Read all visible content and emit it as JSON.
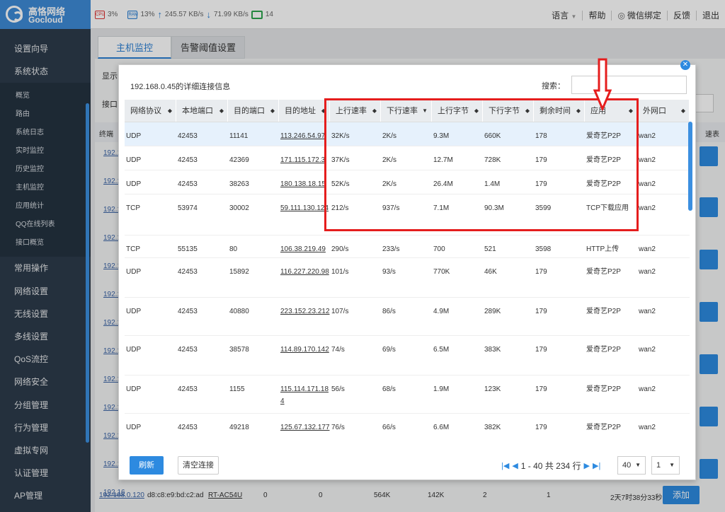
{
  "brand": {
    "name_cn": "高恪网络",
    "name_en": "Gocloud"
  },
  "stats": {
    "cpu_icon": "CPU",
    "cpu": "3%",
    "ram_icon": "RAM",
    "ram": "13%",
    "up": "245.57 KB/s",
    "down": "71.99 KB/s",
    "devices": "14"
  },
  "topnav": {
    "language": "语言",
    "help": "帮助",
    "wechat": "微信绑定",
    "feedback": "反馈",
    "logout": "退出"
  },
  "sidebar": {
    "setup": "设置向导",
    "status": "系统状态",
    "sub": [
      "概览",
      "路由",
      "系统日志",
      "实时监控",
      "历史监控",
      "主机监控",
      "应用统计",
      "QQ在线列表",
      "接口概览"
    ],
    "items": [
      "常用操作",
      "网络设置",
      "无线设置",
      "多线设置",
      "QoS流控",
      "网络安全",
      "分组管理",
      "行为管理",
      "虚拟专网",
      "认证管理",
      "AP管理"
    ]
  },
  "tabs": [
    "主机监控",
    "告警阈值设置"
  ],
  "background": {
    "display_label": "显示",
    "iface_label": "接口",
    "terminal_label": "终端",
    "speed_label": "速表",
    "row_ip": "192.16",
    "bottom": {
      "ip": "192.168.0.120",
      "mac": "d8:c8:e9:bd:c2:ad",
      "model": "RT-AC54U",
      "c1": "0",
      "c2": "0",
      "c3": "564K",
      "c4": "142K",
      "c5": "2",
      "c6": "1",
      "uptime": "2天7时38分33秒",
      "add": "添加"
    }
  },
  "modal": {
    "title": "192.168.0.45的详细连接信息",
    "search_label": "搜索：",
    "search_value": "",
    "columns": [
      "网络协议",
      "本地端口",
      "目的端口",
      "目的地址",
      "上行速率",
      "下行速率",
      "上行字节",
      "下行字节",
      "剩余时间",
      "应用",
      "外网口"
    ],
    "rows": [
      [
        "UDP",
        "42453",
        "11141",
        "113.246.54.97",
        "32K/s",
        "2K/s",
        "9.3M",
        "660K",
        "178",
        "爱奇艺P2P",
        "wan2"
      ],
      [
        "UDP",
        "42453",
        "42369",
        "171.115.172.3",
        "37K/s",
        "2K/s",
        "12.7M",
        "728K",
        "179",
        "爱奇艺P2P",
        "wan2"
      ],
      [
        "UDP",
        "42453",
        "38263",
        "180.138.18.15",
        "52K/s",
        "2K/s",
        "26.4M",
        "1.4M",
        "179",
        "爱奇艺P2P",
        "wan2"
      ],
      [
        "TCP",
        "53974",
        "30002",
        "59.111.130.124",
        "212/s",
        "937/s",
        "7.1M",
        "90.3M",
        "3599",
        "TCP下载应用",
        "wan2"
      ],
      [
        "TCP",
        "55135",
        "80",
        "106.38.219.49",
        "290/s",
        "233/s",
        "700",
        "521",
        "3598",
        "HTTP上传",
        "wan2"
      ],
      [
        "UDP",
        "42453",
        "15892",
        "116.227.220.98",
        "101/s",
        "93/s",
        "770K",
        "46K",
        "179",
        "爱奇艺P2P",
        "wan2"
      ],
      [
        "UDP",
        "42453",
        "40880",
        "223.152.23.212",
        "107/s",
        "86/s",
        "4.9M",
        "289K",
        "179",
        "爱奇艺P2P",
        "wan2"
      ],
      [
        "UDP",
        "42453",
        "38578",
        "114.89.170.142",
        "74/s",
        "69/s",
        "6.5M",
        "383K",
        "179",
        "爱奇艺P2P",
        "wan2"
      ],
      [
        "UDP",
        "42453",
        "1155",
        "115.114.171.184",
        "56/s",
        "68/s",
        "1.9M",
        "123K",
        "179",
        "爱奇艺P2P",
        "wan2"
      ],
      [
        "UDP",
        "42453",
        "49218",
        "125.67.132.177",
        "76/s",
        "66/s",
        "6.6M",
        "382K",
        "179",
        "爱奇艺P2P",
        "wan2"
      ]
    ],
    "refresh": "刷新",
    "clear": "清空连接",
    "pager_text": "1 - 40 共 234 行",
    "page_size": "40",
    "page": "1"
  }
}
